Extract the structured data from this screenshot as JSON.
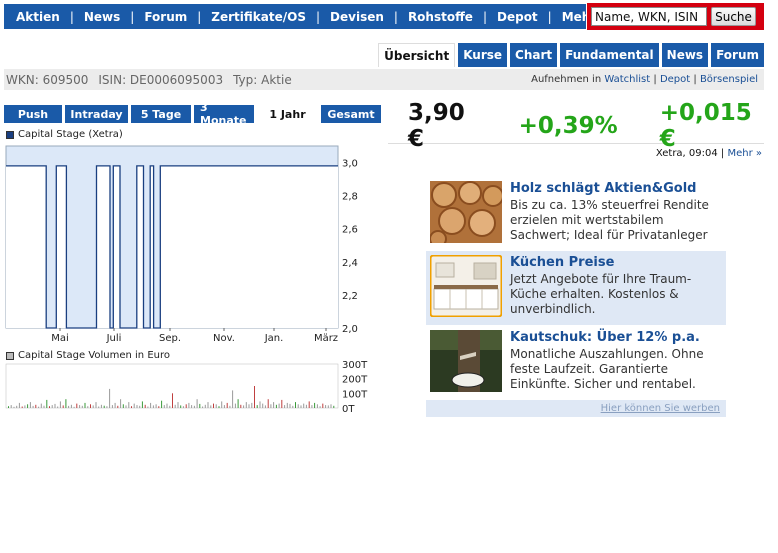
{
  "nav": {
    "items": [
      "Aktien",
      "News",
      "Forum",
      "Zertifikate/OS",
      "Devisen",
      "Rohstoffe",
      "Depot",
      "Mehr"
    ],
    "separator": "|",
    "search_placeholder": "Name, WKN, ISIN",
    "search_button": "Suche"
  },
  "subtabs": [
    "Übersicht",
    "Kurse",
    "Chart",
    "Fundamental",
    "News",
    "Forum"
  ],
  "info": {
    "wkn": "WKN: 609500",
    "isin": "ISIN: DE0006095003",
    "typ": "Typ: Aktie",
    "aufnehmen": "Aufnehmen in",
    "watchlist": "Watchlist",
    "depot": "Depot",
    "boersenspiel": "Börsenspiel",
    "sep": "|"
  },
  "ranges": [
    "Push",
    "Intraday",
    "5 Tage",
    "3 Monate",
    "1 Jahr",
    "Gesamt"
  ],
  "quote": {
    "price": "3,90 €",
    "change_pct": "+0,39%",
    "change_abs": "+0,015 €",
    "exchange_time": "Xetra, 09:04",
    "more": "Mehr »",
    "positive_color": "#24a519"
  },
  "chart_data": [
    {
      "type": "line",
      "title": "Capital Stage (Xetra)",
      "y_ticks": [
        "3,0",
        "2,8",
        "2,6",
        "2,4",
        "2,2",
        "2,0"
      ],
      "x_ticks": [
        "Mai",
        "Juli",
        "Sep.",
        "Nov.",
        "Jan.",
        "März"
      ],
      "ylim": [
        2.0,
        3.0
      ],
      "series": [
        {
          "values": [
            2.98,
            2.98,
            2.98,
            2.98,
            2.98,
            2.98,
            2.98,
            2.98,
            2.98,
            2.98,
            2.98,
            2.98,
            2.0,
            2.0,
            2.0,
            2.98,
            2.98,
            2.98,
            2.0,
            2.0,
            2.0,
            2.0,
            2.0,
            2.0,
            2.0,
            2.0,
            2.0,
            2.98,
            2.98,
            2.98,
            2.98,
            2.0,
            2.98,
            2.98,
            2.0,
            2.0,
            2.0,
            2.0,
            2.0,
            2.98,
            2.98,
            2.0,
            2.0,
            2.98,
            2.0,
            2.0,
            2.98,
            2.98,
            2.98,
            2.98,
            2.98,
            2.98,
            2.98,
            2.98,
            2.98,
            2.98,
            2.98,
            2.98,
            2.98,
            2.98,
            2.98,
            2.98,
            2.98,
            2.98,
            2.98,
            2.98,
            2.98,
            2.98,
            2.98,
            2.98,
            2.98,
            2.98,
            2.98,
            2.98,
            2.98,
            2.98,
            2.98,
            2.98,
            2.98,
            2.98,
            2.98,
            2.98,
            2.98,
            2.98,
            2.98,
            2.98,
            2.98,
            2.98,
            2.98,
            2.98,
            2.98,
            2.98,
            2.98,
            2.98,
            2.98,
            2.98,
            2.98,
            2.98,
            2.98,
            2.98
          ]
        }
      ],
      "line_color": "#1a3f80",
      "fill_color": "#dce8f8"
    },
    {
      "type": "bar",
      "title": "Capital Stage Volumen in Euro",
      "y_ticks": [
        "300T",
        "200T",
        "100T",
        "0T"
      ],
      "ylim": [
        0,
        300
      ],
      "values": [
        12,
        20,
        8,
        15,
        35,
        10,
        18,
        25,
        40,
        14,
        22,
        9,
        30,
        16,
        55,
        12,
        20,
        28,
        10,
        45,
        18,
        60,
        14,
        22,
        8,
        30,
        20,
        15,
        35,
        12,
        25,
        18,
        40,
        10,
        22,
        16,
        12,
        130,
        20,
        35,
        15,
        60,
        25,
        18,
        40,
        12,
        30,
        20,
        15,
        45,
        22,
        10,
        35,
        18,
        25,
        12,
        50,
        20,
        30,
        15,
        100,
        22,
        40,
        18,
        12,
        25,
        35,
        20,
        15,
        60,
        28,
        10,
        22,
        40,
        18,
        30,
        25,
        12,
        45,
        20,
        35,
        15,
        120,
        30,
        60,
        22,
        18,
        40,
        25,
        35,
        150,
        20,
        45,
        30,
        18,
        60,
        25,
        40,
        22,
        30,
        55,
        20,
        35,
        28,
        15,
        40,
        25,
        18,
        30,
        22,
        45,
        20,
        35,
        25,
        12,
        30,
        20,
        18,
        25,
        15
      ],
      "colors": {
        "up": "#3a9a3a",
        "down": "#c04040",
        "neutral": "#9a9a9a"
      }
    }
  ],
  "ads": [
    {
      "title": "Holz schlägt Aktien&Gold",
      "body": "Bis zu ca. 13% steuerfrei Rendite erzielen mit wertstabilem Sachwert; Ideal für Privatanleger",
      "icon": "wood-logs-image"
    },
    {
      "title": "Küchen Preise",
      "body": "Jetzt Angebote für Ihre Traum-Küche erhalten. Kostenlos & unverbindlich.",
      "icon": "kitchen-image"
    },
    {
      "title": "Kautschuk: Über 12% p.a.",
      "body": "Monatliche Auszahlungen. Ohne feste Laufzeit. Garantierte Einkünfte. Sicher und rentabel.",
      "icon": "rubber-tree-image"
    }
  ],
  "ad_footer": "Hier können Sie werben"
}
